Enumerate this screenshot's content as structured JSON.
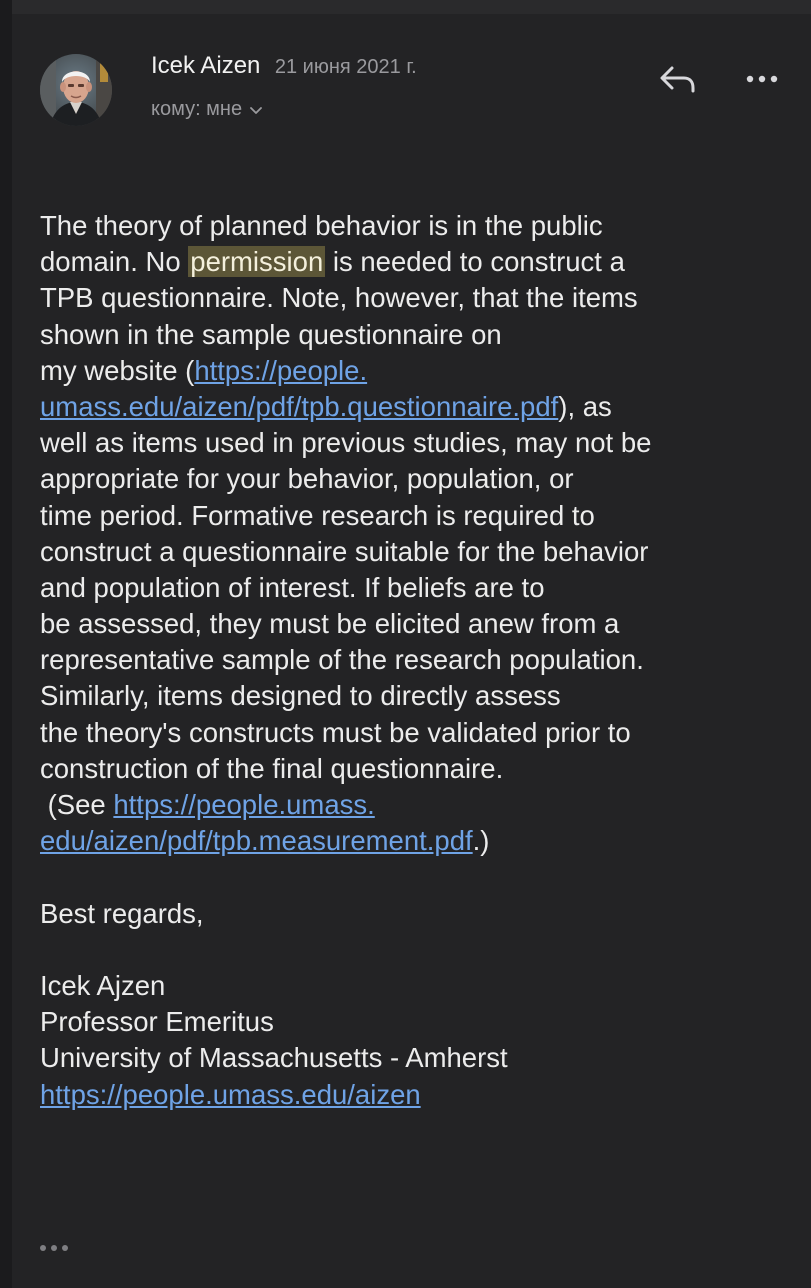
{
  "email": {
    "sender_name": "Icek Aizen",
    "date": "21 июня 2021 г.",
    "recipient": "кому: мне",
    "body_lines": [
      [
        "The theory of planned behavior is in the public"
      ],
      [
        "domain. No ",
        "permission",
        " is needed to construct a"
      ],
      [
        "TPB questionnaire.  Note, however, that the items"
      ],
      [
        "shown in the sample questionnaire on"
      ],
      [
        "my website (",
        "https://people."
      ],
      [
        "umass.edu/aizen/pdf/tpb.questionnaire.pdf",
        "), as"
      ],
      [
        "well as items used in previous studies, may not be"
      ],
      [
        "appropriate for your behavior, population, or"
      ],
      [
        "time period. Formative research is required to"
      ],
      [
        "construct a questionnaire suitable for the behavior"
      ],
      [
        "and population of interest. If beliefs are to"
      ],
      [
        "be assessed, they must be elicited anew from a"
      ],
      [
        "representative sample of the research population."
      ],
      [
        "Similarly, items designed to directly assess"
      ],
      [
        "the theory's constructs must be validated prior to"
      ],
      [
        "construction of the final questionnaire."
      ],
      [
        " (See ",
        "https://people.umass."
      ],
      [
        "edu/aizen/pdf/tpb.measurement.pdf",
        ".)"
      ]
    ],
    "closing": "Best regards,",
    "signature": {
      "name": "Icek Ajzen",
      "title": "Professor Emeritus",
      "affiliation": "University of Massachusetts - Amherst",
      "url": "https://people.umass.edu/aizen"
    }
  },
  "icons": {
    "reply": "reply-arrow-icon",
    "more": "more-horizontal-icon",
    "chevron": "chevron-down-icon",
    "footer_more": "quoted-text-ellipsis-icon"
  },
  "colors": {
    "background": "#232325",
    "text": "#ececec",
    "muted": "#9a9a9e",
    "link": "#6fa3e6",
    "highlight": "#5c5637"
  }
}
